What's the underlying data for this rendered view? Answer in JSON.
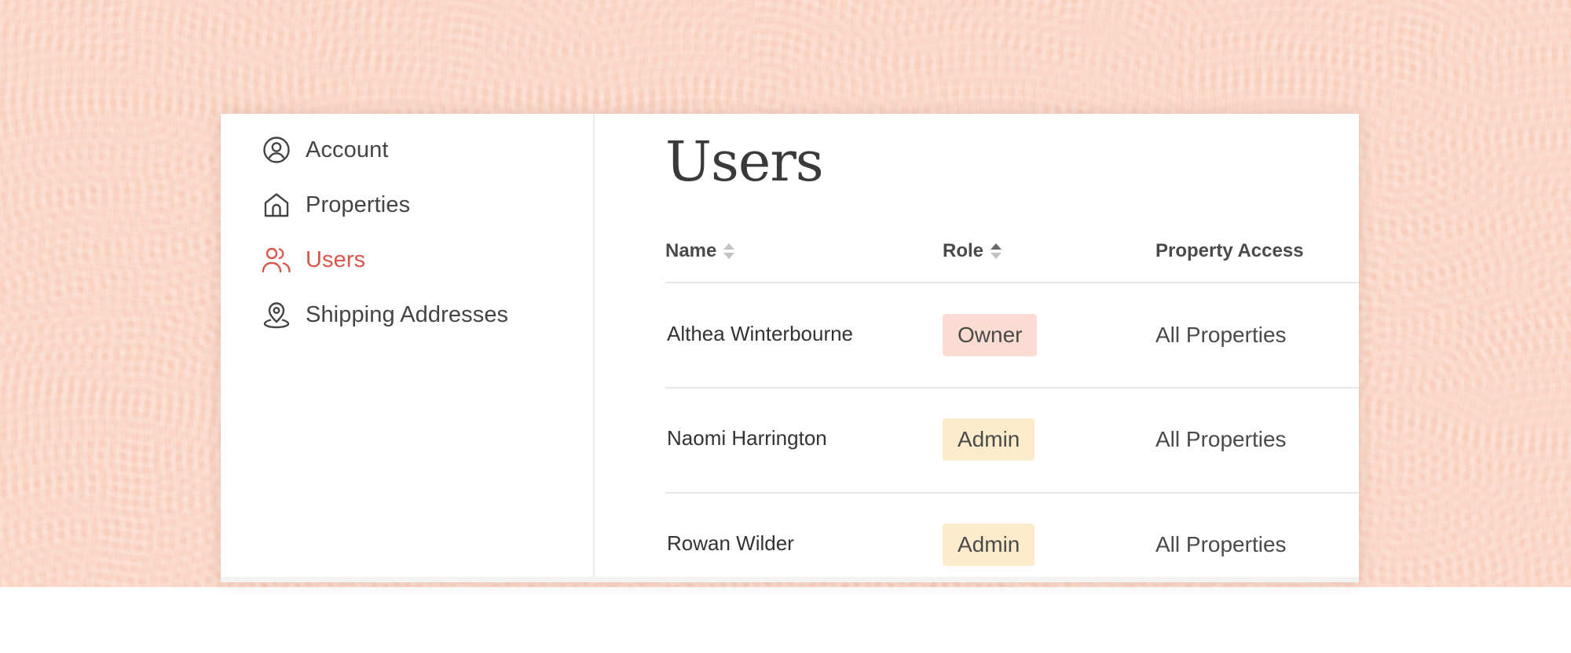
{
  "colors": {
    "accent": "#d9574a",
    "text": "#444444",
    "owner_badge": "#fbdcd3",
    "admin_badge": "#fdeccc",
    "background": "#f8cdbb"
  },
  "sidebar": {
    "items": [
      {
        "label": "Account",
        "icon": "account-circle-icon",
        "active": false
      },
      {
        "label": "Properties",
        "icon": "home-icon",
        "active": false
      },
      {
        "label": "Users",
        "icon": "users-icon",
        "active": true
      },
      {
        "label": "Shipping Addresses",
        "icon": "location-pin-icon",
        "active": false
      }
    ]
  },
  "main": {
    "title": "Users",
    "table": {
      "columns": [
        "Name",
        "Role",
        "Property Access"
      ],
      "rows": [
        {
          "name": "Althea Winterbourne",
          "role": "Owner",
          "access": "All Properties"
        },
        {
          "name": "Naomi Harrington",
          "role": "Admin",
          "access": "All Properties"
        },
        {
          "name": "Rowan Wilder",
          "role": "Admin",
          "access": "All Properties"
        }
      ]
    }
  }
}
